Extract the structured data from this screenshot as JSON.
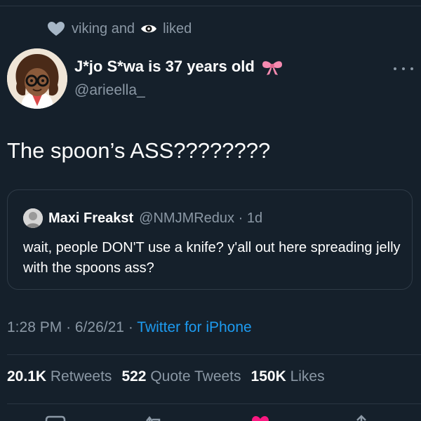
{
  "liked_bar": {
    "name1": "viking and",
    "name2": "liked"
  },
  "tweet": {
    "display_name": "J*jo S*wa is 37 years old",
    "handle": "@arieella_",
    "text": "The spoon’s ASS????????",
    "time": "1:28 PM",
    "date": "6/26/21",
    "source": "Twitter for iPhone",
    "separator": "·"
  },
  "quoted_tweet": {
    "name": "Maxi Freakst",
    "handle": "@NMJMRedux",
    "age": "1d",
    "text": "wait, people DON'T use a knife? y'all out here spreading jelly with the spoons ass?"
  },
  "stats": {
    "retweets": {
      "count": "20.1K",
      "label": "Retweets"
    },
    "quotes": {
      "count": "522",
      "label": "Quote Tweets"
    },
    "likes": {
      "count": "150K",
      "label": "Likes"
    }
  },
  "icons": {
    "liked": "heart-icon",
    "liker_avatar": "eye-icon",
    "badge": "bow-icon",
    "more": "more-icon",
    "reply": "reply-icon",
    "retweet": "retweet-icon",
    "like": "like-icon",
    "share": "share-icon"
  },
  "colors": {
    "background": "#15202b",
    "text": "#ffffff",
    "secondary": "#8b98a5",
    "accent": "#1d9bf0",
    "like": "#f91880",
    "border": "#2f3b47"
  }
}
